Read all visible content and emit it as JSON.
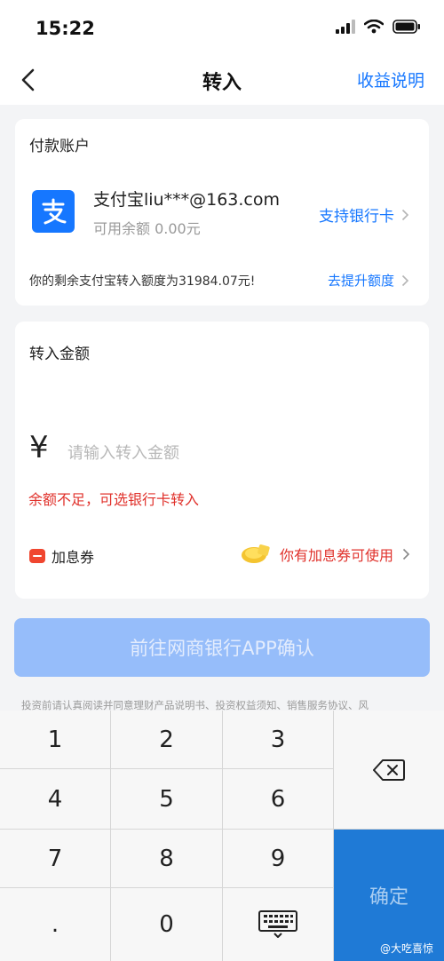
{
  "status": {
    "time": "15:22"
  },
  "nav": {
    "title": "转入",
    "action": "收益说明"
  },
  "pay_card": {
    "label": "付款账户",
    "account_name": "支付宝liu***@163.com",
    "balance": "可用余额 0.00元",
    "support_link": "支持银行卡",
    "quota_text": "你的剩余支付宝转入额度为31984.07元!",
    "quota_link": "去提升额度"
  },
  "amount_card": {
    "label": "转入金额",
    "currency": "¥",
    "placeholder": "请输入转入金额",
    "warning": "余额不足，可选银行卡转入",
    "coupon_label": "加息券",
    "coupon_link": "你有加息券可使用"
  },
  "confirm_button": "前往网商银行APP确认",
  "agreement": "投资前请认真阅读并同意理财产品说明书、投资权益须知、销售服务协议、风",
  "keypad": {
    "keys": [
      "1",
      "2",
      "3",
      "4",
      "5",
      "6",
      "7",
      "8",
      "9",
      ".",
      "0"
    ],
    "ok": "确定"
  },
  "watermark": "@大吃喜惊",
  "colors": {
    "accent": "#1677ff",
    "warning": "#e0312b",
    "confirm_disabled": "#96bdfa",
    "ok_key": "#1f7ad6"
  },
  "icons": [
    "back-arrow-icon",
    "alipay-logo-icon",
    "chevron-right-icon",
    "coupon-icon",
    "coupon-coin-icon",
    "backspace-icon",
    "keyboard-icon"
  ]
}
